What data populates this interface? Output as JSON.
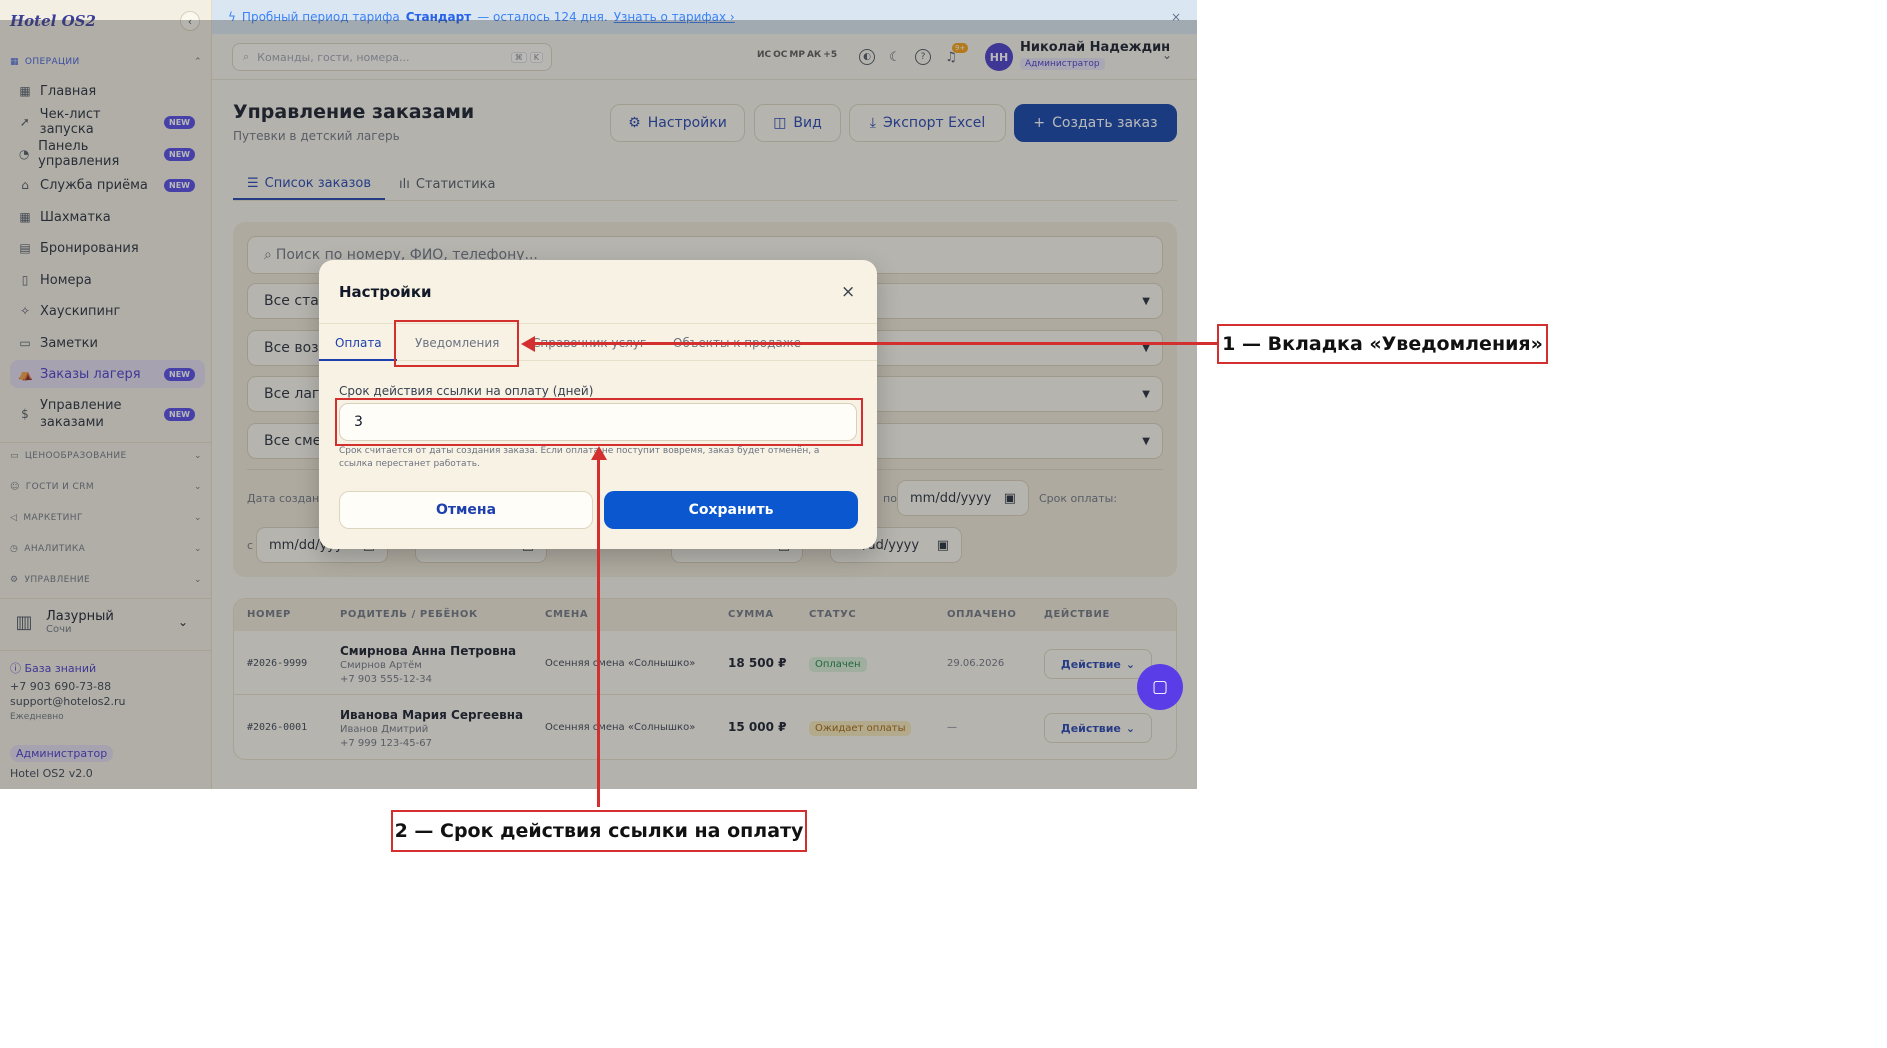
{
  "app": {
    "logo": "Hotel OS2",
    "collapse_icon": "‹"
  },
  "banner": {
    "text_before": "Пробный период тарифа",
    "plan": "Стандарт",
    "text_after": "— осталось 124 дня.",
    "link": "Узнать о тарифах ›",
    "close": "×"
  },
  "topbar": {
    "search_placeholder": "Команды, гости, номера...",
    "kbd1": "⌘",
    "kbd2": "K",
    "avatars": [
      "ИС",
      "ОС",
      "МР",
      "АК",
      "+5"
    ],
    "notif_count": "9+",
    "user_initials": "НН",
    "user_name": "Николай Надеждин",
    "user_role": "Администратор"
  },
  "sidebar": {
    "sections": {
      "operations": "ОПЕРАЦИИ",
      "pricing": "ЦЕНООБРАЗОВАНИЕ",
      "guests": "ГОСТИ И CRM",
      "marketing": "МАРКЕТИНГ",
      "analytics": "АНАЛИТИКА",
      "management": "УПРАВЛЕНИЕ"
    },
    "items": [
      {
        "label": "Главная",
        "icon": "▦"
      },
      {
        "label": "Чек-лист запуска",
        "icon": "➚",
        "badge": "NEW"
      },
      {
        "label": "Панель управления",
        "icon": "◔",
        "badge": "NEW"
      },
      {
        "label": "Служба приёма",
        "icon": "⌂",
        "badge": "NEW"
      },
      {
        "label": "Шахматка",
        "icon": "▦"
      },
      {
        "label": "Бронирования",
        "icon": "▤"
      },
      {
        "label": "Номера",
        "icon": "▯"
      },
      {
        "label": "Хаускипинг",
        "icon": "✧"
      },
      {
        "label": "Заметки",
        "icon": "▭"
      },
      {
        "label": "Заказы лагеря",
        "icon": "⛺",
        "badge": "NEW"
      },
      {
        "label": "Управление заказами",
        "icon": "$",
        "badge": "NEW"
      }
    ],
    "hotel_name": "Лазурный",
    "hotel_city": "Сочи",
    "knowledge_base": "База знаний",
    "phone": "+7 903 690-73-88",
    "email": "support@hotelos2.ru",
    "schedule": "Ежедневно",
    "role_badge": "Администратор",
    "version": "Hotel OS2 v2.0"
  },
  "main": {
    "title": "Управление заказами",
    "subtitle": "Путевки в детский лагерь",
    "buttons": {
      "settings": "Настройки",
      "view": "Вид",
      "export": "Экспорт Excel",
      "create": "Создать заказ"
    },
    "tabs": [
      "Список заказов",
      "Статистика"
    ],
    "filters": {
      "search_placeholder": "Поиск по номеру, ФИО, телефону...",
      "status": "Все стат",
      "age": "Все воз",
      "camp": "Все лаге",
      "shift": "Все сме",
      "created_label": "Дата создани",
      "to_label": "по",
      "pay_due_label": "Срок оплаты:",
      "from_label": "с",
      "date_placeholder": "mm/dd/yyyy",
      "date_placeholder_short": "mm/dd/yyy",
      "date_placeholder_tail": "/dd/yyyy"
    },
    "table": {
      "headers": [
        "НОМЕР",
        "РОДИТЕЛЬ / РЕБЁНОК",
        "СМЕНА",
        "СУММА",
        "СТАТУС",
        "ОПЛАЧЕНО",
        "ДЕЙСТВИЕ"
      ],
      "rows": [
        {
          "id": "#2026-9999",
          "parent": "Смирнова Анна Петровна",
          "child": "Смирнов Артём",
          "phone": "+7 903 555-12-34",
          "shift": "Осенняя смена «Солнышко»",
          "sum": "18 500 ₽",
          "status": "Оплачен",
          "paid": "29.06.2026",
          "action": "Действие"
        },
        {
          "id": "#2026-0001",
          "parent": "Иванова Мария Сергеевна",
          "child": "Иванов Дмитрий",
          "phone": "+7 999 123-45-67",
          "shift": "Осенняя смена «Солнышко»",
          "sum": "15 000 ₽",
          "status": "Ожидает оплаты",
          "paid": "—",
          "action": "Действие"
        }
      ]
    }
  },
  "modal": {
    "title": "Настройки",
    "close": "×",
    "tabs": [
      "Оплата",
      "Уведомления",
      "Справочник услуг",
      "Объекты к продаже"
    ],
    "field_label": "Срок действия ссылки на оплату (дней)",
    "field_value": "3",
    "help": "Срок считается от даты создания заказа. Если оплата не поступит вовремя, заказ будет отменён, а ссылка перестанет работать.",
    "cancel": "Отмена",
    "save": "Сохранить"
  },
  "annotations": {
    "one": "1 — Вкладка «Уведомления»",
    "two": "2 — Срок действия ссылки на оплату"
  },
  "colors": {
    "accent": "#1e40af",
    "primary_button": "#0b57d0",
    "annotation": "#d32f2f",
    "sidebar_active": "#4338ca"
  }
}
